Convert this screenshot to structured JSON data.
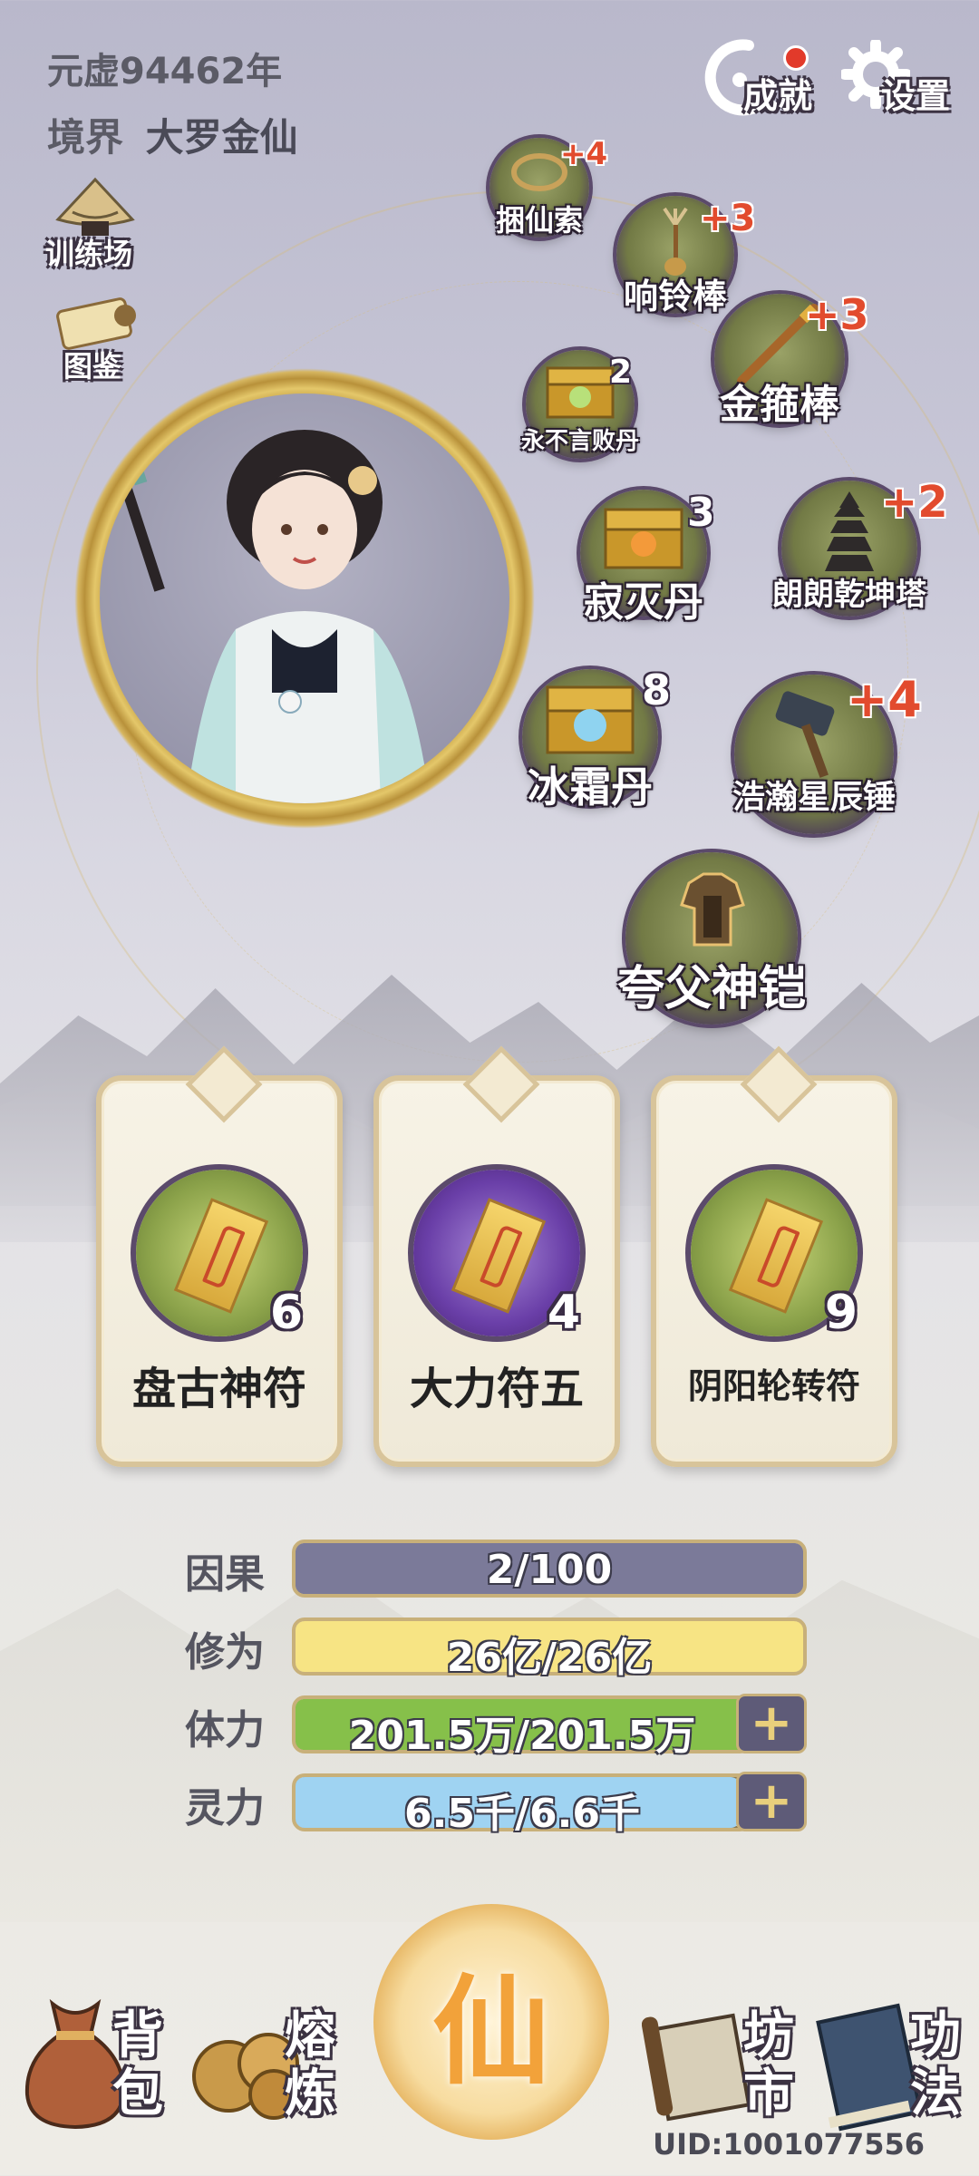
{
  "header": {
    "era": "元虚94462年",
    "realm_label": "境界",
    "realm_value": "大罗金仙",
    "achievements_label": "成就",
    "settings_label": "设置"
  },
  "side_buttons": {
    "training_label": "训练场",
    "codex_label": "图鉴"
  },
  "equipment": [
    {
      "name": "捆仙索",
      "level": "+4"
    },
    {
      "name": "响铃棒",
      "level": "+3"
    },
    {
      "name": "金箍棒",
      "level": "+3"
    },
    {
      "name": "永不言败丹",
      "count": "2"
    },
    {
      "name": "寂灭丹",
      "count": "3"
    },
    {
      "name": "朗朗乾坤塔",
      "level": "+2"
    },
    {
      "name": "冰霜丹",
      "count": "8"
    },
    {
      "name": "浩瀚星辰锤",
      "level": "+4"
    },
    {
      "name": "夸父神铠"
    }
  ],
  "talismans": [
    {
      "name": "盘古神符",
      "count": "6",
      "color": "#8ba24a"
    },
    {
      "name": "大力符五",
      "count": "4",
      "color": "#6a3fa8"
    },
    {
      "name": "阴阳轮转符",
      "count": "9",
      "color": "#8ba24a"
    }
  ],
  "stats": [
    {
      "label": "因果",
      "value": "2/100",
      "fill_fraction": 1.0,
      "color": "#7b7a99"
    },
    {
      "label": "修为",
      "value": "26亿/26亿",
      "fill_fraction": 1.0,
      "color": "#f7e484"
    },
    {
      "label": "体力",
      "value": "201.5万/201.5万",
      "fill_fraction": 1.0,
      "color": "#86c04a"
    },
    {
      "label": "灵力",
      "value": "6.5千/6.6千",
      "fill_fraction": 0.98,
      "color": "#9fd3f2"
    }
  ],
  "nav": {
    "bag": "背包",
    "smelt": "熔炼",
    "immortal": "仙",
    "market": "坊市",
    "skills": "功法"
  },
  "uid": "UID:1001077556"
}
